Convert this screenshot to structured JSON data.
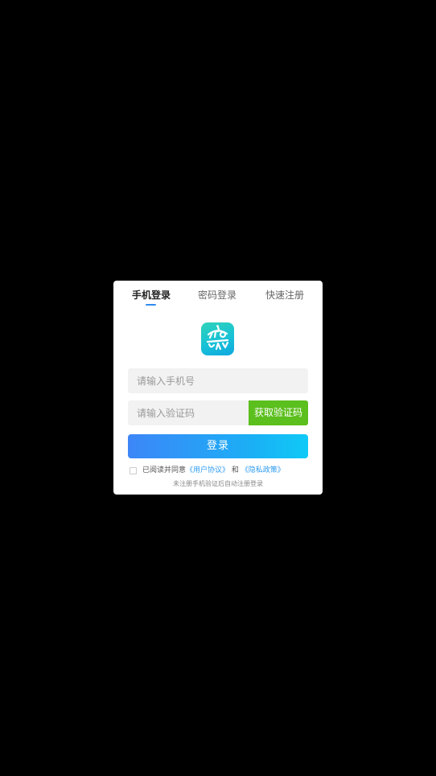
{
  "tabs": {
    "phone_login": "手机登录",
    "password_login": "密码登录",
    "quick_register": "快速注册",
    "active": "phone_login"
  },
  "logo": {
    "icon": "app-logo-icon",
    "colors": [
      "#2fd3b8",
      "#0ea6e0"
    ]
  },
  "form": {
    "phone_placeholder": "请输入手机号",
    "phone_value": "",
    "code_placeholder": "请输入验证码",
    "code_value": "",
    "get_code_label": "获取验证码",
    "login_label": "登录"
  },
  "agreement": {
    "prefix": "已阅读并同意",
    "user_agreement": "《用户协议》",
    "conjunction": "和",
    "privacy_policy": "《隐私政策》",
    "checked": false
  },
  "hint": "未注册手机验证后自动注册登录",
  "colors": {
    "accent": "#2d8cf0",
    "code_button": "#5bbf1d",
    "link": "#2d9cf0"
  }
}
